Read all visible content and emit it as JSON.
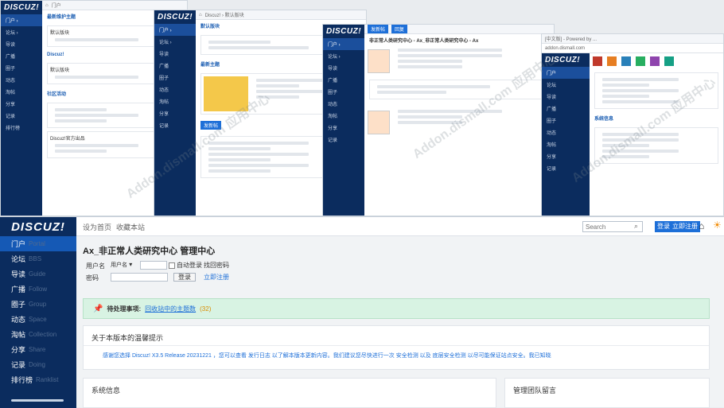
{
  "thumbs": {
    "t1": {
      "logo": "DISCUZ!",
      "crumb": "门户",
      "sections": [
        "最新维护主题",
        "Discuz!",
        "社区活动"
      ],
      "posts": [
        "默认版块",
        "默认版块",
        "Discuz!官方出品"
      ]
    },
    "t2": {
      "logo": "DISCUZ!",
      "crumb": "Discuz! › 默认版块",
      "forum": "默认版块",
      "section": "最新主题",
      "btn": "发新帖"
    },
    "t3": {
      "logo": "DISCUZ!",
      "thread": "非正常人类研究中心 - Ax_非正常人类研究中心 - Ax",
      "btn": "发新帖",
      "reply": "回复"
    },
    "t4": {
      "title": "[中文版] - Powered by ...",
      "url": "addon.dismall.com",
      "section": "系统信息"
    }
  },
  "top": {
    "logo": "DISCUZ!",
    "links": [
      "设为首页",
      "收藏本站"
    ],
    "search_placeholder": "Search",
    "login_label": "登录",
    "register_label": "立即注册",
    "icons": {
      "search": "search-icon",
      "home": "home-icon",
      "theme": "sun-icon"
    }
  },
  "sidebar": {
    "items": [
      {
        "label": "门户",
        "en": "Portal",
        "active": true
      },
      {
        "label": "论坛",
        "en": "BBS"
      },
      {
        "label": "导读",
        "en": "Guide"
      },
      {
        "label": "广播",
        "en": "Follow"
      },
      {
        "label": "圈子",
        "en": "Group"
      },
      {
        "label": "动态",
        "en": "Space"
      },
      {
        "label": "淘帖",
        "en": "Collection"
      },
      {
        "label": "分享",
        "en": "Share"
      },
      {
        "label": "记录",
        "en": "Doing"
      },
      {
        "label": "排行榜",
        "en": "Ranklist"
      }
    ]
  },
  "page": {
    "title": "Ax_非正常人类研究中心 管理中心",
    "user_label": "用户名",
    "user_select": "用户名",
    "password_label": "密码",
    "remember_label": "自动登录",
    "find_password": "找回密码",
    "login_button": "登录",
    "register_link": "立即注册",
    "notice_label": "待处理事项:",
    "notice_link": "回收站中的主题数",
    "notice_count": "(32)",
    "box1_title": "关于本版本的温馨提示",
    "box1_text": "感谢您选择 Discuz! X3.5 Release 20231221 ，您可以查看 发行日志 以了解本版本更新内容。我们建议您尽快进行一次 安全检测 以及 底层安全检测 以尽可能保证站点安全。我已知晓",
    "box2_title": "系统信息",
    "box3_title": "管理团队留言"
  },
  "watermark": "Addon.dismall.com 应用中心"
}
